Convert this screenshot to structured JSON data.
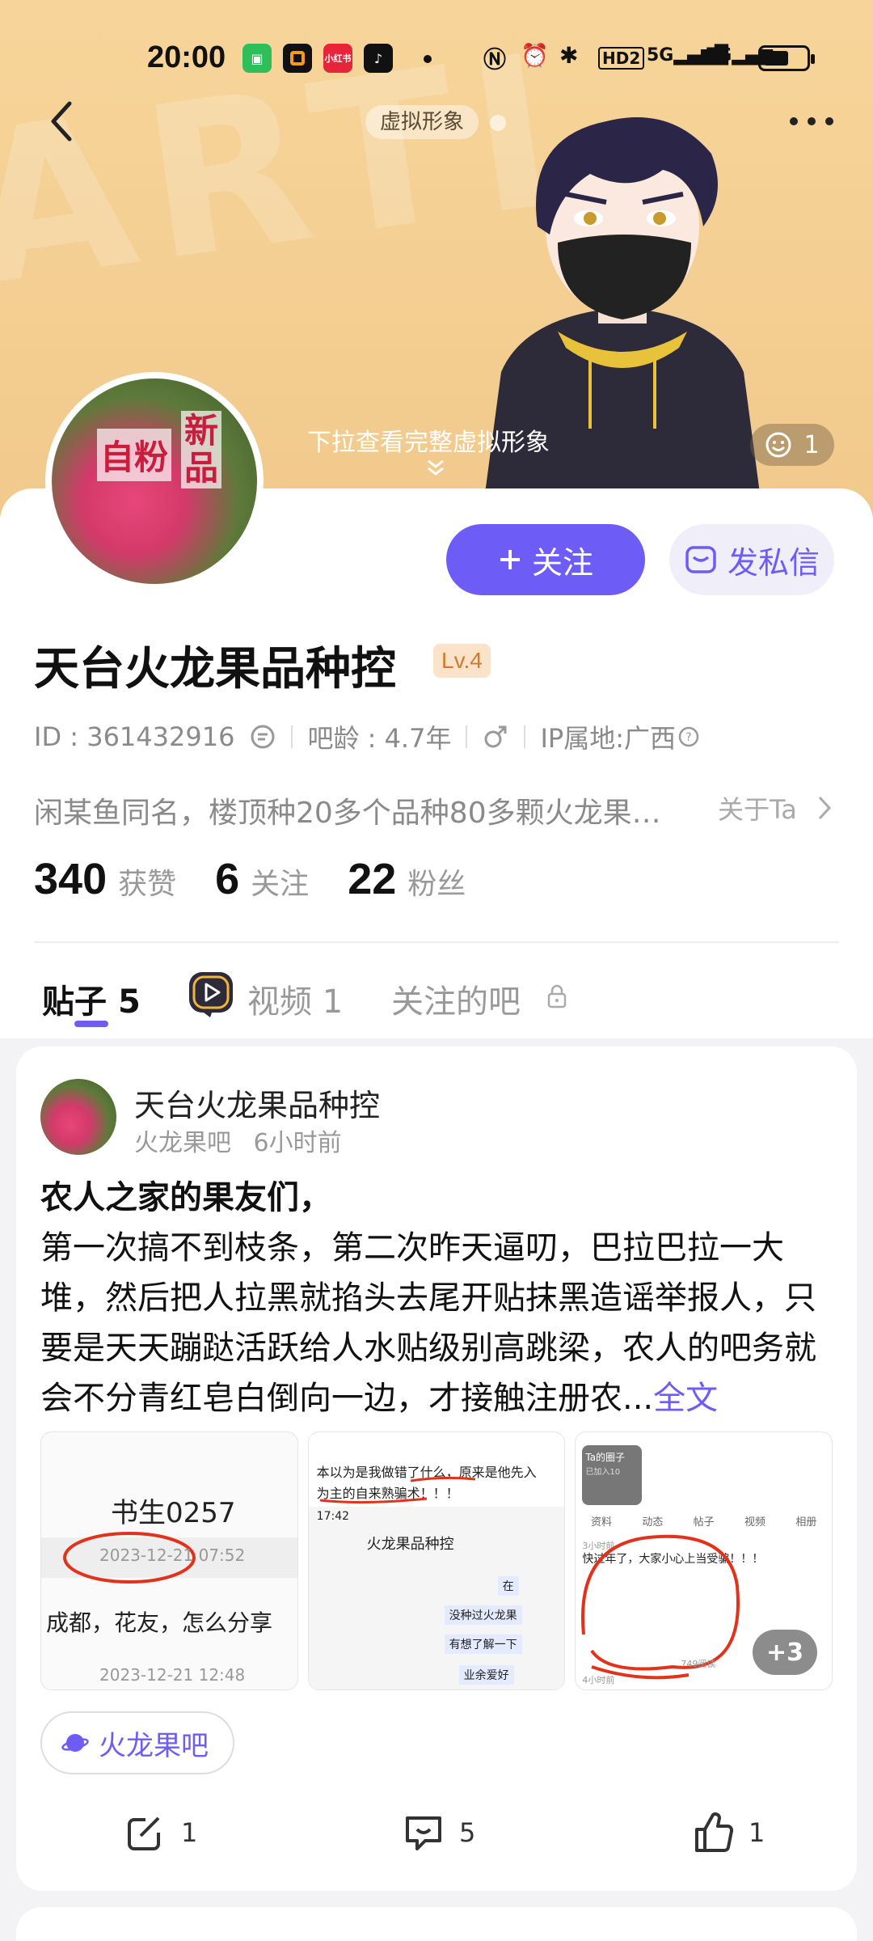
{
  "status_bar": {
    "time": "20:00",
    "apps": [
      "green-bag-app-icon",
      "orange-square-app-icon",
      "xiaohongshu-app-icon",
      "tiktok-app-icon"
    ],
    "xhs_label": "小红书",
    "hd_label": "HD2"
  },
  "banner": {
    "avatar_tag": "虚拟形象",
    "pull_hint": "下拉查看完整虚拟形象",
    "like_count": "1"
  },
  "profile": {
    "avatar_text_1": "自粉",
    "avatar_text_2": "新品",
    "follow_label": "关注",
    "message_label": "发私信",
    "username": "天台火龙果品种控",
    "level": "Lv.4",
    "id_text": "ID : 361432916",
    "bar_age": "吧龄 : 4.7年",
    "ip_location": "IP属地:广西",
    "bio": "闲某鱼同名，楼顶种20多个品种80多颗火龙果…",
    "about_label": "关于Ta",
    "stats": [
      {
        "num": "340",
        "label": "获赞"
      },
      {
        "num": "6",
        "label": "关注"
      },
      {
        "num": "22",
        "label": "粉丝"
      }
    ]
  },
  "tabs": {
    "posts": "贴子",
    "posts_count": "5",
    "videos": "视频 1",
    "followed_bars": "关注的吧"
  },
  "post": {
    "author": "天台火龙果品种控",
    "forum": "火龙果吧",
    "time": "6小时前",
    "headline": "农人之家的果友们，",
    "body": "第一次搞不到枝条，第二次昨天逼叨，巴拉巴拉一大堆，然后把人拉黑就掐头去尾开贴抹黑造谣举报人，只要是天天蹦跶活跃给人水贴级别高跳梁，农人的吧务就会不分青红皂白倒向一边，才接触注册农...",
    "full_text": "全文",
    "thumb1": {
      "name": "书生0257",
      "date1": "2023-12-21 07:52",
      "msg": "成都，花友，怎么分享",
      "date2": "2023-12-21 12:48"
    },
    "thumb2": {
      "line1": "本以为是我做错了什么，原来是他先入",
      "line2": "为主的自来熟骗术！！！",
      "clock": "17:42",
      "title": "火龙果品种控",
      "bubbles": [
        "在",
        "没种过火龙果",
        "有想了解一下",
        "业余爱好"
      ]
    },
    "thumb3": {
      "circle": "Ta的圈子",
      "members": "已加入10",
      "tabs": [
        "资料",
        "动态",
        "帖子",
        "视频",
        "相册"
      ],
      "time": "3小时前",
      "headline": "快过年了，大家小心上当受骗！！！",
      "views": "749阅读",
      "time2": "4小时前"
    },
    "more_images": "+3",
    "forum_chip": "火龙果吧",
    "actions": {
      "share": "1",
      "comment": "5",
      "like": "1"
    }
  },
  "colors": {
    "accent": "#6e5cf6",
    "banner": "#f7d59a",
    "level_bg": "#fbe3cb",
    "level_text": "#d47a2a"
  }
}
